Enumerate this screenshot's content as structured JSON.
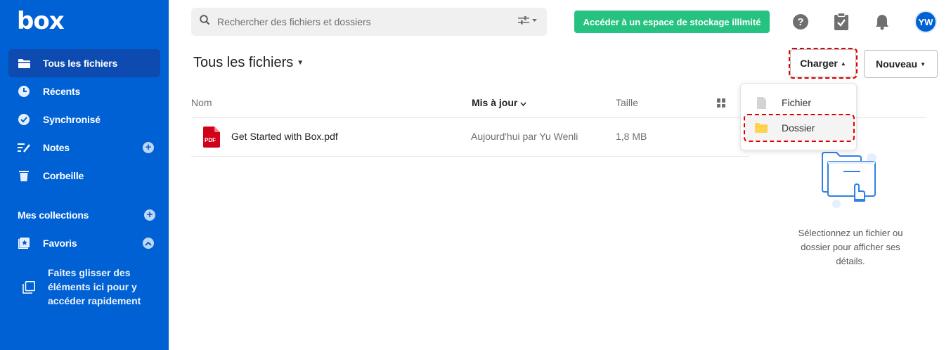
{
  "sidebar": {
    "logo": "box",
    "items": [
      {
        "label": "Tous les fichiers",
        "icon": "folder-icon"
      },
      {
        "label": "Récents",
        "icon": "clock-icon"
      },
      {
        "label": "Synchronisé",
        "icon": "check-circle-icon"
      },
      {
        "label": "Notes",
        "icon": "notes-icon"
      },
      {
        "label": "Corbeille",
        "icon": "trash-icon"
      }
    ],
    "collections_label": "Mes collections",
    "favorites_label": "Favoris",
    "drop_hint": "Faites glisser des éléments ici pour y accéder rapidement"
  },
  "header": {
    "search_placeholder": "Rechercher des fichiers et dossiers",
    "upgrade_label": "Accéder à un espace de stockage illimité",
    "avatar_initials": "YW"
  },
  "main": {
    "title": "Tous les fichiers",
    "upload_label": "Charger",
    "new_label": "Nouveau",
    "columns": {
      "name": "Nom",
      "updated": "Mis à jour",
      "size": "Taille"
    },
    "files": [
      {
        "name": "Get Started with Box.pdf",
        "updated": "Aujourd'hui par Yu Wenli",
        "size": "1,8 MB",
        "type_badge": "PDF"
      }
    ]
  },
  "upload_menu": {
    "file_label": "Fichier",
    "folder_label": "Dossier"
  },
  "details_panel": {
    "empty_text": "Sélectionnez un fichier ou dossier pour afficher ses détails."
  },
  "colors": {
    "brand_blue": "#0061d5",
    "upgrade_green": "#26c281",
    "highlight_red": "#e00000",
    "pdf_red": "#d0021b"
  }
}
